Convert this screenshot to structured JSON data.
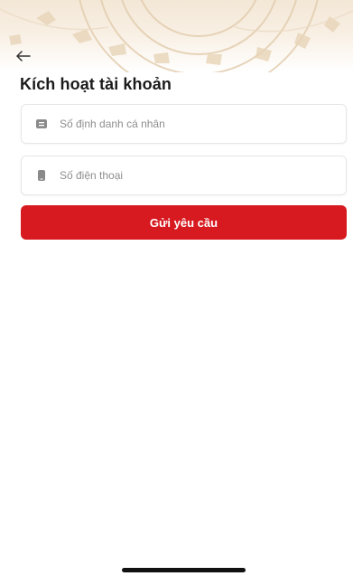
{
  "header": {
    "banner_icon": "decorative-drum-pattern",
    "back_icon": "arrow-left-icon",
    "title": "Kích hoạt tài khoản"
  },
  "form": {
    "id_field": {
      "icon": "id-card-icon",
      "placeholder": "Số định danh cá nhân",
      "value": ""
    },
    "phone_field": {
      "icon": "phone-icon",
      "placeholder": "Số điện thoại",
      "value": ""
    },
    "submit_label": "Gửi yêu cầu"
  },
  "colors": {
    "accent": "#d71920",
    "banner": "#f3e7d6",
    "title": "#1b1b1b",
    "placeholder": "#8e8e8e"
  }
}
